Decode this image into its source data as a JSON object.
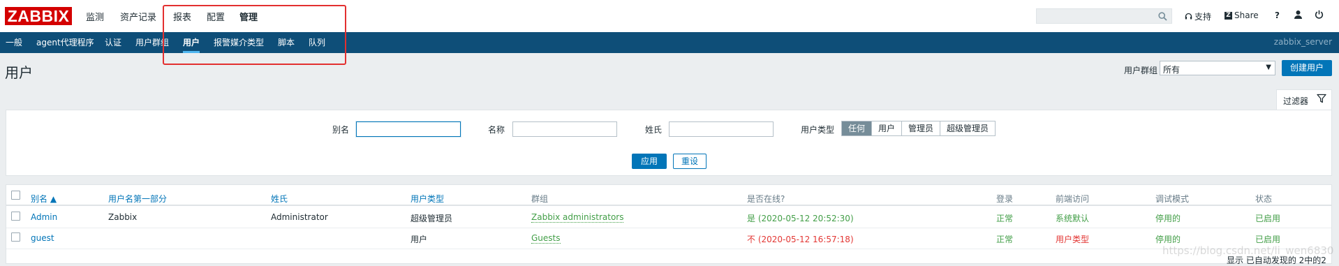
{
  "header": {
    "logo": "ZABBIX",
    "menu": [
      "监测",
      "资产记录",
      "报表",
      "配置",
      "管理"
    ],
    "support": "支持",
    "share": "Share",
    "help": "?"
  },
  "subnav": {
    "items": [
      "一般",
      "agent代理程序",
      "认证",
      "用户群组",
      "用户",
      "报警媒介类型",
      "脚本",
      "队列"
    ],
    "active": "用户",
    "server": "zabbix_server"
  },
  "page": {
    "title": "用户",
    "group_label": "用户群组",
    "group_value": "所有",
    "create_button": "创建用户"
  },
  "filter": {
    "tab_label": "过滤器",
    "alias_label": "别名",
    "name_label": "名称",
    "surname_label": "姓氏",
    "type_label": "用户类型",
    "type_options": [
      "任何",
      "用户",
      "管理员",
      "超级管理员"
    ],
    "type_selected": "任何",
    "apply": "应用",
    "reset": "重设"
  },
  "table": {
    "headers": [
      "别名 ▲",
      "用户名第一部分",
      "姓氏",
      "用户类型",
      "群组",
      "是否在线?",
      "登录",
      "前端访问",
      "调试模式",
      "状态"
    ],
    "rows": [
      {
        "alias": "Admin",
        "name": "Zabbix",
        "surname": "Administrator",
        "type": "超级管理员",
        "groups": "Zabbix administrators",
        "online": "是 (2020-05-12 20:52:30)",
        "login": "正常",
        "frontend": "系统默认",
        "debug": "停用的",
        "status": "已启用"
      },
      {
        "alias": "guest",
        "name": "",
        "surname": "",
        "type": "用户",
        "groups": "Guests",
        "online": "不 (2020-05-12 16:57:18)",
        "login": "正常",
        "frontend": "用户类型",
        "debug": "停用的",
        "status": "已启用"
      }
    ],
    "footer": "显示 已自动发现的 2中的2"
  },
  "watermark": "https://blog.csdn.net/li_wen6830",
  "colors": {
    "brand": "#d40000",
    "nav": "#0e4e78",
    "accent": "#0275b8",
    "ok": "#429e47",
    "bad": "#e33734",
    "highlight": "#e33030"
  }
}
